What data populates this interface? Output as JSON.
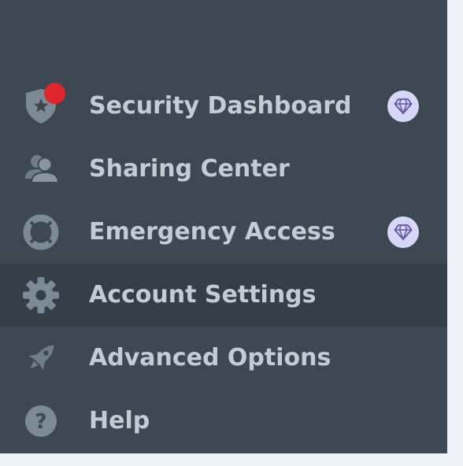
{
  "menu": {
    "items": [
      {
        "label": "Security Dashboard",
        "icon": "shield-star-icon",
        "premium": true,
        "notification": true,
        "active": false
      },
      {
        "label": "Sharing Center",
        "icon": "users-icon",
        "premium": false,
        "notification": false,
        "active": false
      },
      {
        "label": "Emergency Access",
        "icon": "lifebuoy-icon",
        "premium": true,
        "notification": false,
        "active": false
      },
      {
        "label": "Account Settings",
        "icon": "gear-icon",
        "premium": false,
        "notification": false,
        "active": true
      },
      {
        "label": "Advanced Options",
        "icon": "rocket-icon",
        "premium": false,
        "notification": false,
        "active": false
      },
      {
        "label": "Help",
        "icon": "question-circle-icon",
        "premium": false,
        "notification": false,
        "active": false
      }
    ]
  },
  "colors": {
    "sidebar_bg": "#3d4852",
    "active_row_bg": "#353f48",
    "label_text": "#c3ccd6",
    "icon": "#7c8a96",
    "notification_dot": "#e0262b",
    "premium_badge_bg": "#d7d6f4",
    "premium_badge_icon": "#5b55a3"
  }
}
